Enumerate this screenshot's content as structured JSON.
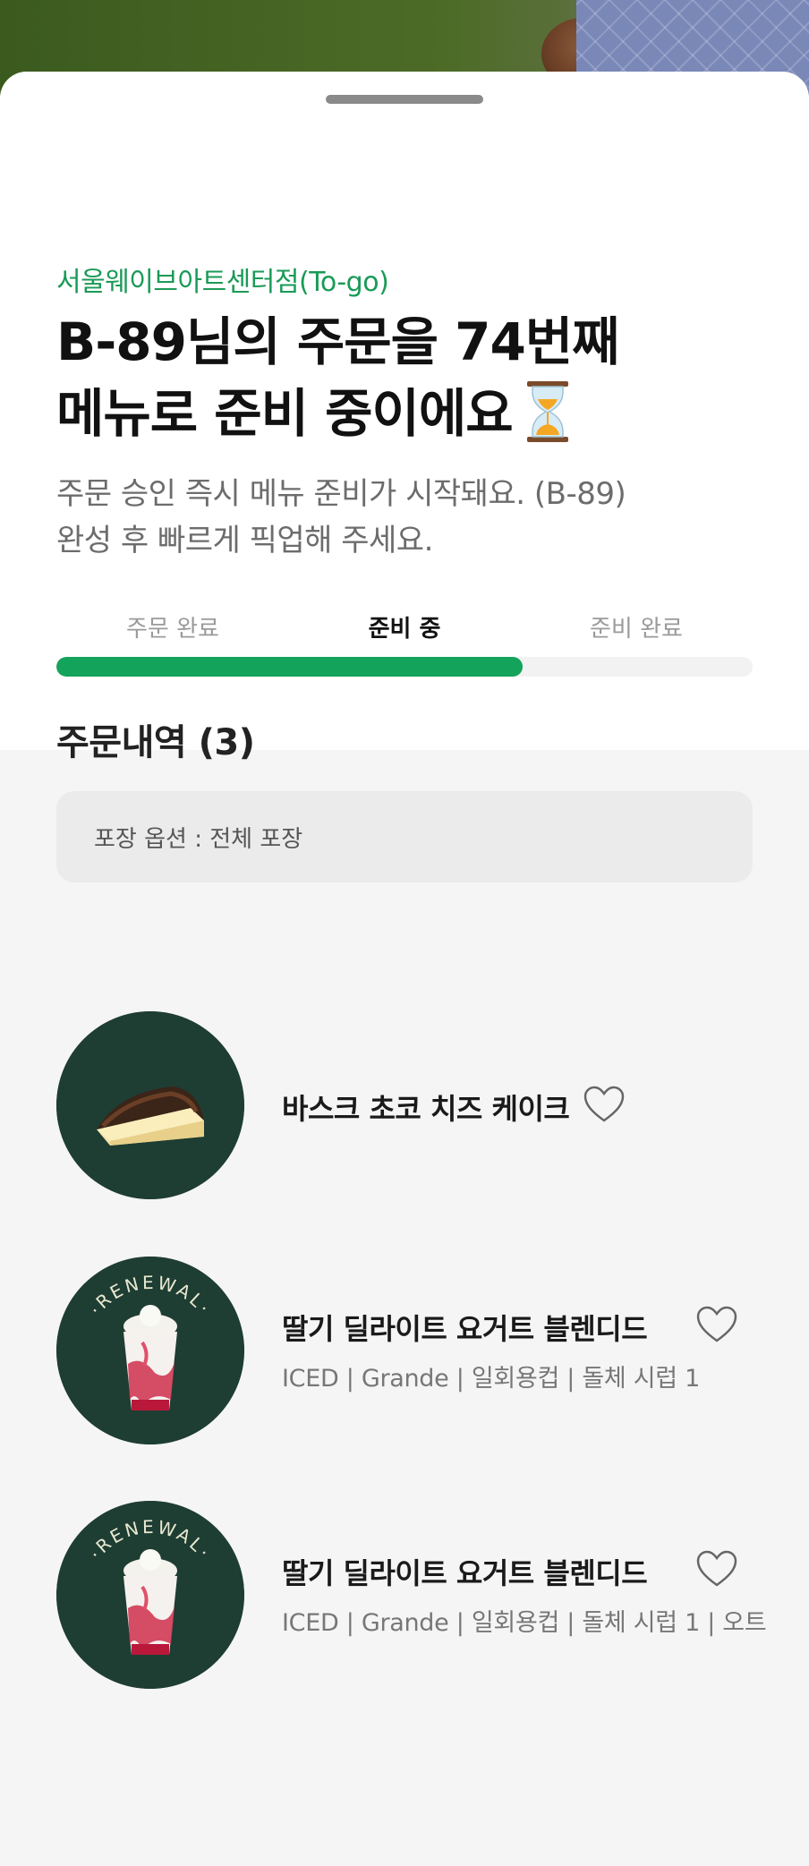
{
  "store": {
    "name": "서울웨이브아트센터점(To-go)"
  },
  "headline": {
    "line1": "B-89님의 주문을 74번째",
    "line2": "메뉴로 준비 중이에요"
  },
  "subtext": {
    "line1": "주문 승인 즉시 메뉴 준비가 시작돼요. (B-89)",
    "line2": "완성 후 빠르게 픽업해 주세요."
  },
  "steps": [
    {
      "label": "주문 완료",
      "active": false
    },
    {
      "label": "준비 중",
      "active": true
    },
    {
      "label": "준비 완료",
      "active": false
    }
  ],
  "progress": {
    "fraction": 0.67,
    "color": "#13a35a"
  },
  "order": {
    "title": "주문내역 (3)",
    "packaging": "포장 옵션 : 전체 포장"
  },
  "items": [
    {
      "name": "바스크 초코 치즈 케이크",
      "options": "",
      "image": "cake-image"
    },
    {
      "name": "딸기 딜라이트 요거트 블렌디드",
      "options": "ICED | Grande | 일회용컵 | 돌체 시럽 1",
      "image": "drink-image",
      "badge": "RENEWAL"
    },
    {
      "name": "딸기 딜라이트 요거트 블렌디드",
      "options": "ICED | Grande | 일회용컵 | 돌체 시럽 1 | 오트",
      "image": "drink-image",
      "badge": "RENEWAL"
    }
  ],
  "colors": {
    "brand": "#1a9a57",
    "thumb_bg": "#1e3d33"
  }
}
